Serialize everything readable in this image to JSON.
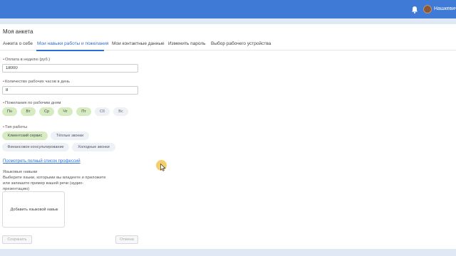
{
  "header": {
    "username": "Нашкевич А",
    "bell_icon": "bell-icon",
    "avatar_icon": "avatar",
    "accent": "#3f7ad7"
  },
  "page": {
    "title": "Моя анкета"
  },
  "tabs": [
    {
      "label": "Анкета о себе",
      "active": false
    },
    {
      "label": "Мои навыки работы и пожелания",
      "active": true
    },
    {
      "label": "Мои контактные данные",
      "active": false
    },
    {
      "label": "Изменить пароль",
      "active": false
    },
    {
      "label": "Выбор рабочего устройства",
      "active": false
    }
  ],
  "form": {
    "pay": {
      "label": "Оплата в неделю (руб.)",
      "value": "18000"
    },
    "hours": {
      "label": "Количество рабочих часов в день",
      "value": "8"
    },
    "days": {
      "label": "Пожелания по рабочим дням",
      "items": [
        {
          "label": "Пн",
          "selected": true
        },
        {
          "label": "Вт",
          "selected": true
        },
        {
          "label": "Ср",
          "selected": true
        },
        {
          "label": "Чт",
          "selected": true
        },
        {
          "label": "Пт",
          "selected": true
        },
        {
          "label": "Сб",
          "selected": false
        },
        {
          "label": "Вс",
          "selected": false
        }
      ]
    },
    "work_type": {
      "label": "Тип работы",
      "items": [
        {
          "label": "Клиентский сервис",
          "selected": true
        },
        {
          "label": "Тёплые звонки",
          "selected": false
        },
        {
          "label": "Финансовое консультирование",
          "selected": false
        },
        {
          "label": "Холодные звонки",
          "selected": false
        }
      ]
    },
    "professions_link": "Посмотреть полный список профессий",
    "languages": {
      "title": "Языковые навыки",
      "description": "Выберите языки, которыми вы владеете и приложите или запишите пример вашей речи (аудио-презентацию)",
      "add_label": "Добавить языковой навык"
    },
    "save_label": "Сохранить",
    "cancel_label": "Отмена"
  },
  "colors": {
    "selected_chip": "#d6ecc0",
    "unselected_chip": "#eef1f5",
    "link": "#2a6fd6"
  }
}
